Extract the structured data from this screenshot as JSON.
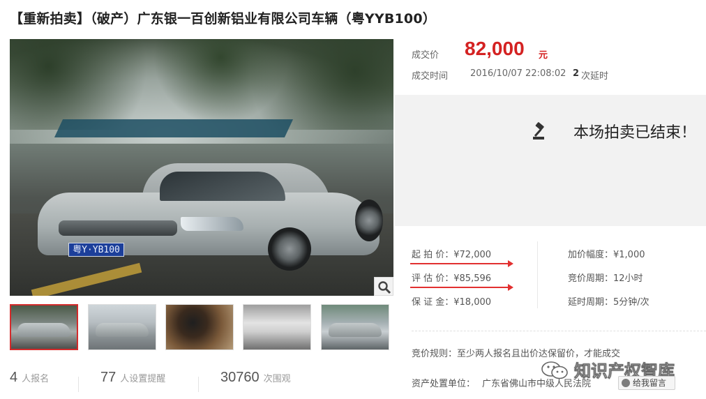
{
  "title": "【重新拍卖】（破产）广东银一百创新铝业有限公司车辆（粤YYB100）",
  "price": {
    "label": "成交价",
    "value": "82,000",
    "unit": "元",
    "time_label": "成交时间",
    "time_value": "2016/10/07 22:08:02",
    "delay_count": "2",
    "delay_label": "次延时"
  },
  "status": {
    "message": "本场拍卖已结束！",
    "icon": "gavel-icon"
  },
  "params": {
    "start_price": "起 拍 价：¥72,000",
    "appraisal": "评 估 价：¥85,596",
    "deposit": "保 证 金：¥18,000",
    "increment": "加价幅度：¥1,000",
    "period": "竞价周期：12小时",
    "delay_period": "延时周期：5分钟/次"
  },
  "rule": "竞价规则：至少两人报名且出价达保留价，才能成交",
  "org": {
    "label": "资产处置单位：",
    "value": "广东省佛山市中级人民法院"
  },
  "message_button": "给我留言",
  "watermark": "知识产权智库",
  "plate_text": "粤Y·YB100",
  "stats": [
    {
      "num": "4",
      "label": "人报名"
    },
    {
      "num": "77",
      "label": "人设置提醒"
    },
    {
      "num": "30760",
      "label": "次围观"
    }
  ],
  "colors": {
    "accent_red": "#d42222",
    "panel_gray": "#f2f2f2"
  }
}
